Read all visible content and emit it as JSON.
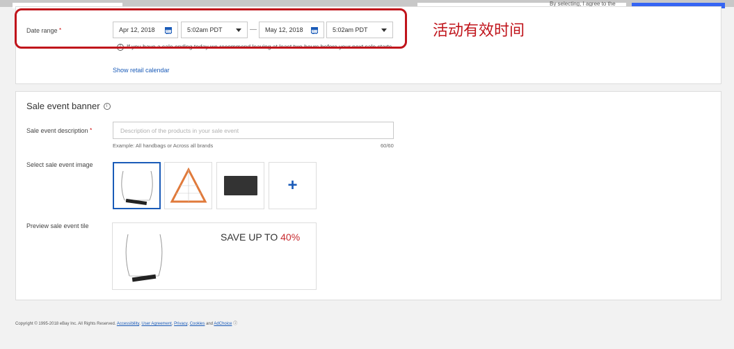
{
  "header": {
    "terms_text": "By selecting, I agree to the"
  },
  "date_range": {
    "label": "Date range",
    "required_mark": "*",
    "start_date": "Apr 12, 2018",
    "start_time": "5:02am PDT",
    "separator": "—",
    "end_date": "May 12, 2018",
    "end_time": "5:02am PDT",
    "warning": "If you have a sale ending today we recommend leaving at least two hours before your next sale starts.",
    "retail_calendar_link": "Show retail calendar"
  },
  "annotation": {
    "text": "活动有效时间",
    "color": "#c0141b"
  },
  "banner": {
    "title": "Sale event banner",
    "description_label": "Sale event description",
    "required_mark": "*",
    "description_placeholder": "Description of the products in your sale event",
    "example_hint": "Example: All handbags or Across all brands",
    "char_count": "60/60",
    "image_label": "Select sale event image",
    "add_symbol": "+",
    "preview_label": "Preview sale event tile",
    "preview_text": "SAVE UP TO",
    "preview_percent": "40%"
  },
  "footer": {
    "copyright": "Copyright © 1995-2018 eBay Inc. All Rights Reserved.",
    "links": [
      "Accessibility",
      "User Agreement",
      "Privacy",
      "Cookies"
    ],
    "and_text": "and",
    "adchoice": "AdChoice"
  },
  "colors": {
    "accent": "#1a5bb8",
    "highlight": "#c0141b",
    "sale_percent": "#c72a2f"
  }
}
